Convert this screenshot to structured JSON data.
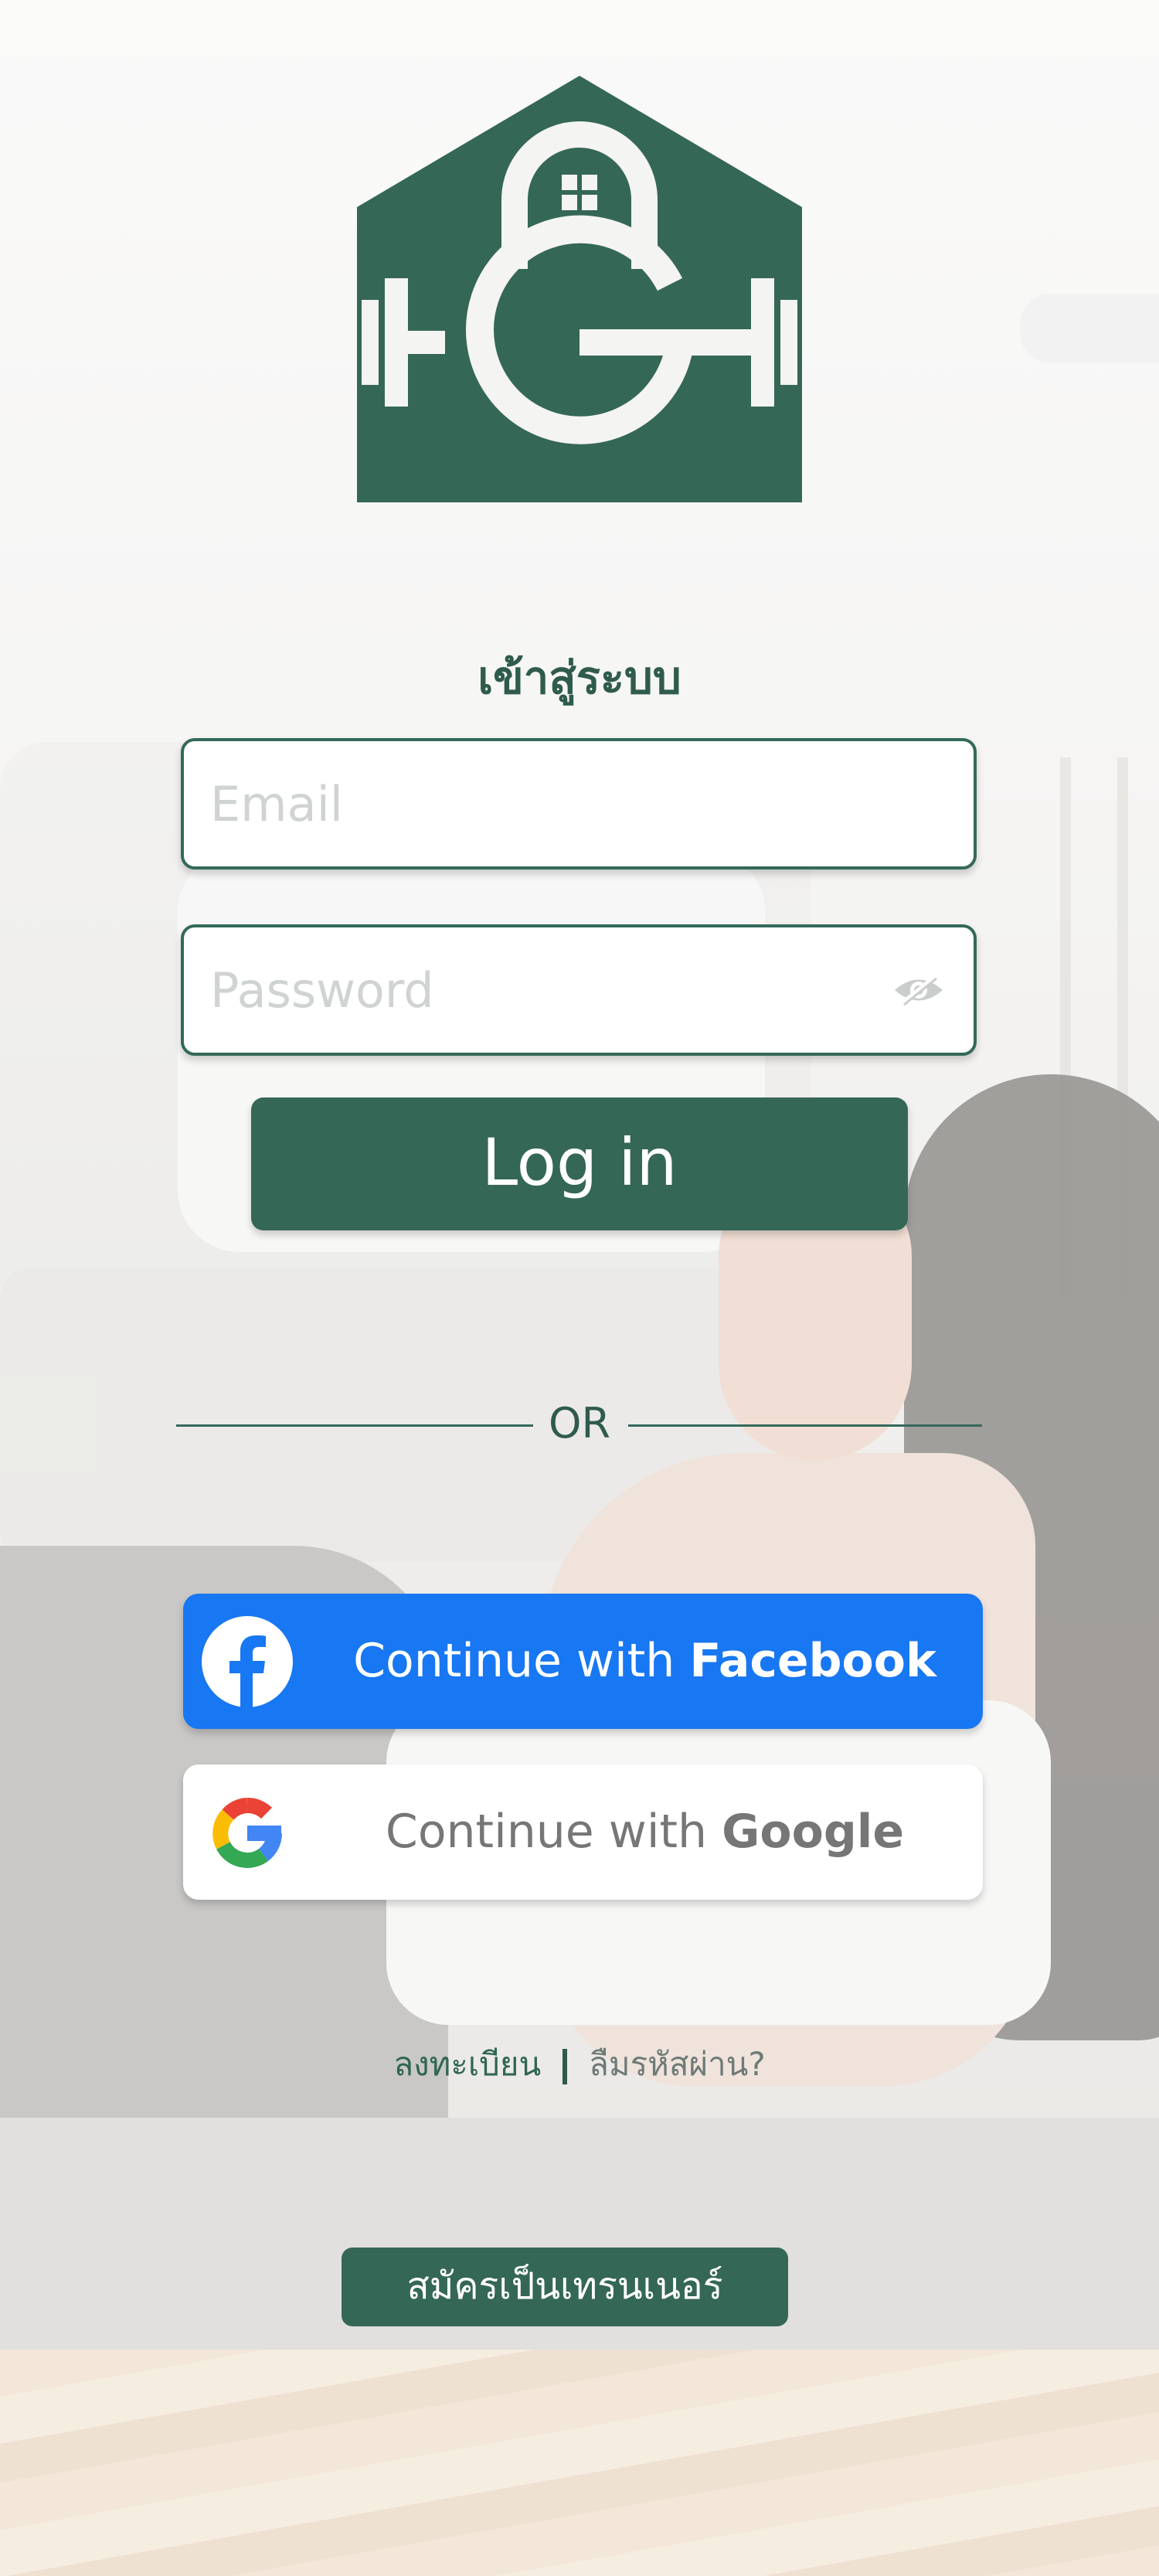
{
  "login": {
    "title": "เข้าสู่ระบบ",
    "email_placeholder": "Email",
    "password_placeholder": "Password",
    "login_label": "Log in",
    "or_label": "OR"
  },
  "social": {
    "facebook_prefix": "Continue with ",
    "facebook_brand": "Facebook",
    "google_prefix": "Continue with ",
    "google_brand": "Google"
  },
  "links": {
    "register": "ลงทะเบียน",
    "forgot_password": "ลืมรหัสผ่าน?"
  },
  "trainer_signup_label": "สมัครเป็นเทรนเนอร์",
  "colors": {
    "brand_green": "#356756",
    "facebook_blue": "#1877f2",
    "placeholder_gray": "#cfd3d2"
  },
  "icons": [
    "gym-house-logo",
    "eye-slash-icon",
    "facebook-icon",
    "google-icon"
  ]
}
